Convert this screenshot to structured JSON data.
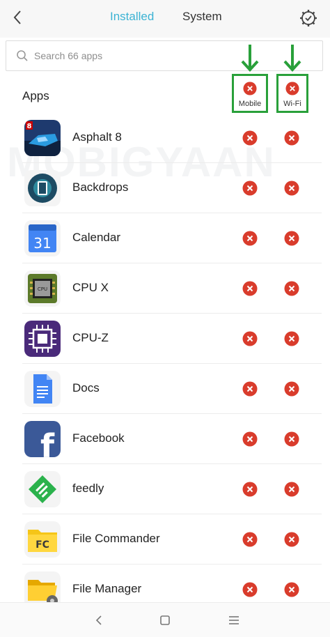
{
  "header": {
    "tabs": [
      {
        "label": "Installed",
        "active": true
      },
      {
        "label": "System",
        "active": false
      }
    ]
  },
  "search": {
    "placeholder": "Search 66 apps"
  },
  "list_header": {
    "title": "Apps",
    "columns": [
      {
        "label": "Mobile",
        "state": "blocked"
      },
      {
        "label": "Wi-Fi",
        "state": "blocked"
      }
    ]
  },
  "watermark": "MOBIGYAAN",
  "apps": [
    {
      "name": "Asphalt 8",
      "icon": "asphalt8-icon",
      "mobile": "blocked",
      "wifi": "blocked"
    },
    {
      "name": "Backdrops",
      "icon": "backdrops-icon",
      "mobile": "blocked",
      "wifi": "blocked"
    },
    {
      "name": "Calendar",
      "icon": "calendar-icon",
      "icon_text": "31",
      "mobile": "blocked",
      "wifi": "blocked"
    },
    {
      "name": "CPU X",
      "icon": "cpux-icon",
      "icon_text": "CPU",
      "mobile": "blocked",
      "wifi": "blocked"
    },
    {
      "name": "CPU-Z",
      "icon": "cpuz-icon",
      "mobile": "blocked",
      "wifi": "blocked"
    },
    {
      "name": "Docs",
      "icon": "docs-icon",
      "mobile": "blocked",
      "wifi": "blocked"
    },
    {
      "name": "Facebook",
      "icon": "facebook-icon",
      "icon_text": "f",
      "mobile": "blocked",
      "wifi": "blocked"
    },
    {
      "name": "feedly",
      "icon": "feedly-icon",
      "mobile": "blocked",
      "wifi": "blocked"
    },
    {
      "name": "File Commander",
      "icon": "file-commander-icon",
      "icon_text": "FC",
      "mobile": "blocked",
      "wifi": "blocked"
    },
    {
      "name": "File Manager",
      "icon": "file-manager-icon",
      "mobile": "blocked",
      "wifi": "blocked"
    }
  ],
  "colors": {
    "accent": "#3cb3d4",
    "blocked": "#d93c2c",
    "highlight": "#29a03a"
  }
}
